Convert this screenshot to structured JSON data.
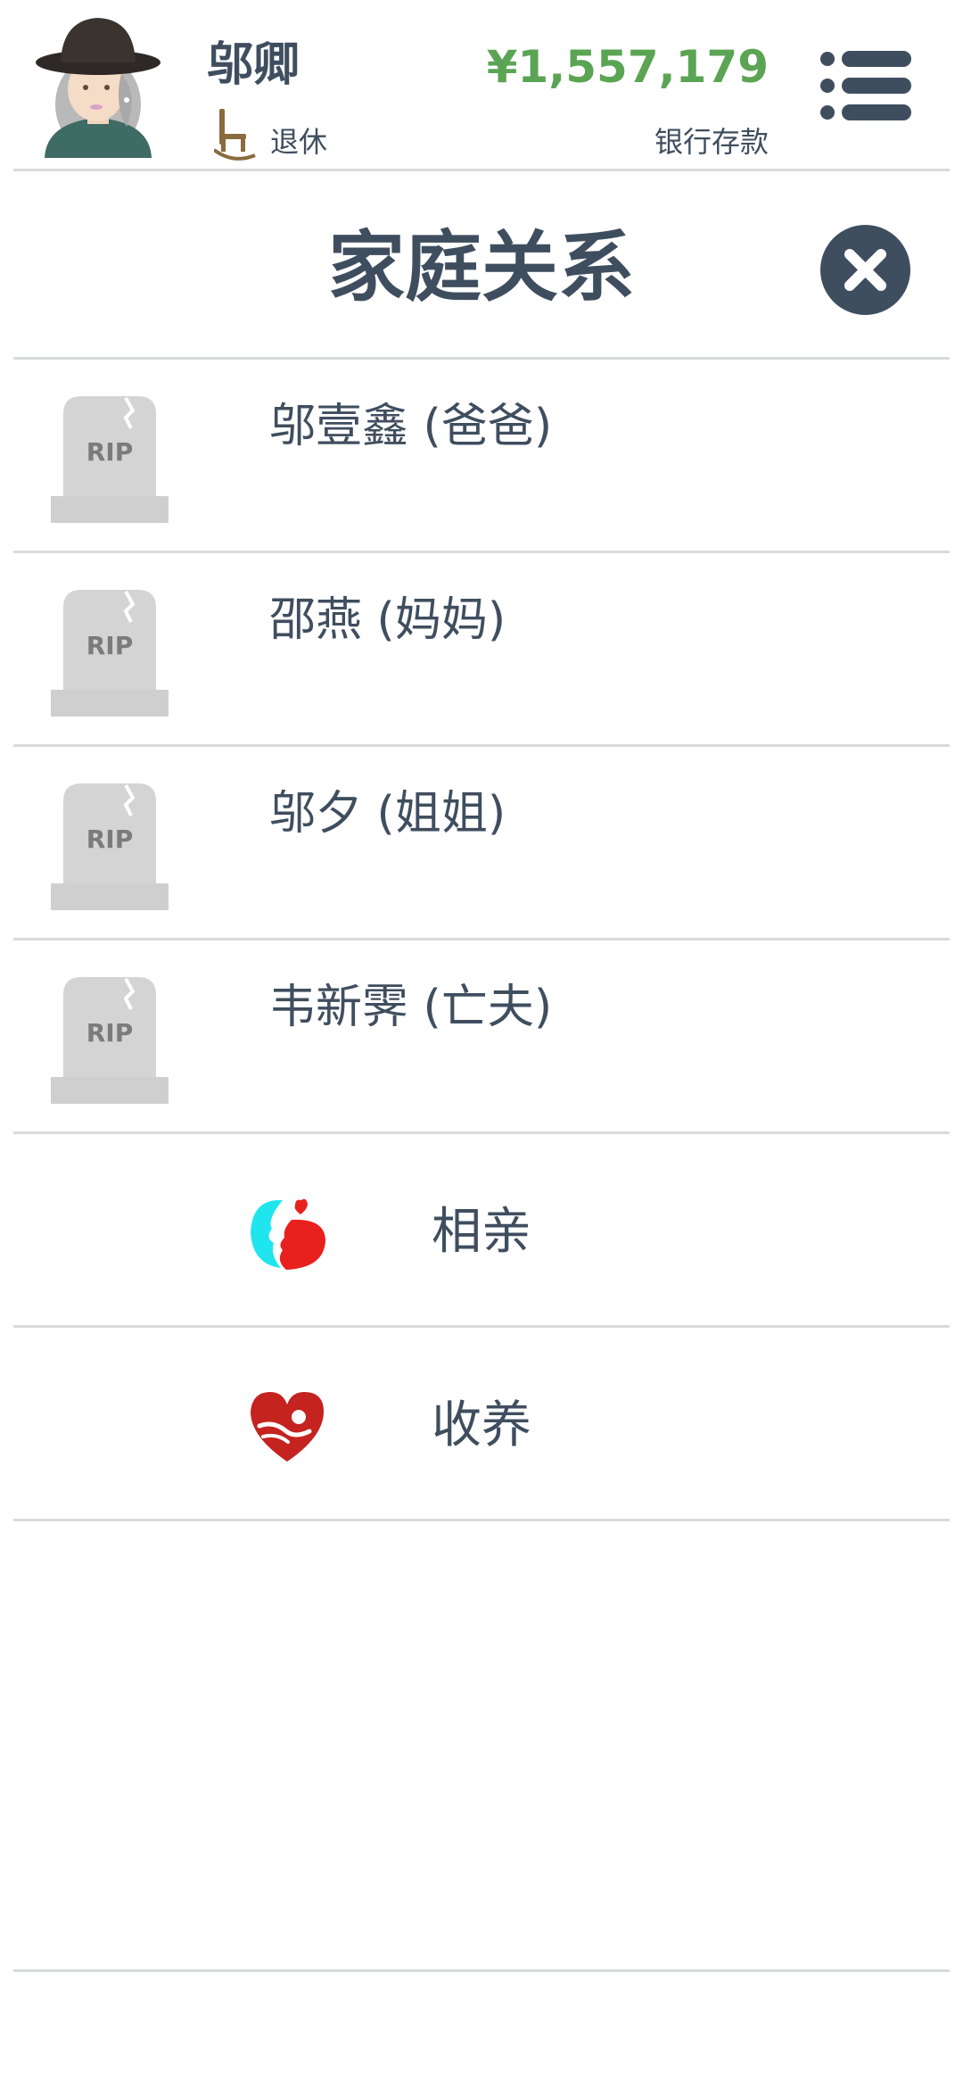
{
  "header": {
    "character_name": "邬卿",
    "status_label": "退休",
    "money": "¥1,557,179",
    "money_label": "银行存款"
  },
  "section": {
    "title": "家庭关系"
  },
  "family": [
    {
      "name": "邬壹鑫 (爸爸)",
      "icon": "rip-tombstone-icon"
    },
    {
      "name": "邵燕 (妈妈)",
      "icon": "rip-tombstone-icon"
    },
    {
      "name": "邬夕 (姐姐)",
      "icon": "rip-tombstone-icon"
    },
    {
      "name": "韦新霁 (亡夫)",
      "icon": "rip-tombstone-icon"
    }
  ],
  "actions": [
    {
      "label": "相亲",
      "icon": "dating-couple-icon"
    },
    {
      "label": "收养",
      "icon": "adopt-heart-icon"
    }
  ],
  "tombstone_text": "RIP",
  "colors": {
    "text": "#3f4e5f",
    "money": "#5aa454",
    "divider": "#d9dadd",
    "tombstone": "#d4d4d4"
  }
}
